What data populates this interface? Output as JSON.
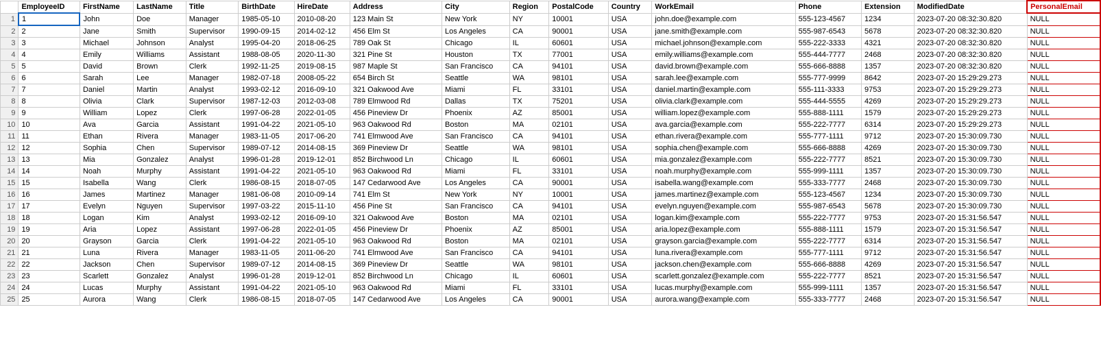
{
  "columns": [
    {
      "key": "rowNum",
      "label": ""
    },
    {
      "key": "employeeId",
      "label": "EmployeeID"
    },
    {
      "key": "firstName",
      "label": "FirstName"
    },
    {
      "key": "lastName",
      "label": "LastName"
    },
    {
      "key": "title",
      "label": "Title"
    },
    {
      "key": "birthDate",
      "label": "BirthDate"
    },
    {
      "key": "hireDate",
      "label": "HireDate"
    },
    {
      "key": "address",
      "label": "Address"
    },
    {
      "key": "city",
      "label": "City"
    },
    {
      "key": "region",
      "label": "Region"
    },
    {
      "key": "postalCode",
      "label": "PostalCode"
    },
    {
      "key": "country",
      "label": "Country"
    },
    {
      "key": "workEmail",
      "label": "WorkEmail"
    },
    {
      "key": "phone",
      "label": "Phone"
    },
    {
      "key": "extension",
      "label": "Extension"
    },
    {
      "key": "modifiedDate",
      "label": "ModifiedDate"
    },
    {
      "key": "personalEmail",
      "label": "PersonalEmail"
    }
  ],
  "rows": [
    {
      "rowNum": 1,
      "employeeId": "1",
      "firstName": "John",
      "lastName": "Doe",
      "title": "Manager",
      "birthDate": "1985-05-10",
      "hireDate": "2010-08-20",
      "address": "123 Main St",
      "city": "New York",
      "region": "NY",
      "postalCode": "10001",
      "country": "USA",
      "workEmail": "john.doe@example.com",
      "phone": "555-123-4567",
      "extension": "1234",
      "modifiedDate": "2023-07-20 08:32:30.820",
      "personalEmail": "NULL"
    },
    {
      "rowNum": 2,
      "employeeId": "2",
      "firstName": "Jane",
      "lastName": "Smith",
      "title": "Supervisor",
      "birthDate": "1990-09-15",
      "hireDate": "2014-02-12",
      "address": "456 Elm St",
      "city": "Los Angeles",
      "region": "CA",
      "postalCode": "90001",
      "country": "USA",
      "workEmail": "jane.smith@example.com",
      "phone": "555-987-6543",
      "extension": "5678",
      "modifiedDate": "2023-07-20 08:32:30.820",
      "personalEmail": "NULL"
    },
    {
      "rowNum": 3,
      "employeeId": "3",
      "firstName": "Michael",
      "lastName": "Johnson",
      "title": "Analyst",
      "birthDate": "1995-04-20",
      "hireDate": "2018-06-25",
      "address": "789 Oak St",
      "city": "Chicago",
      "region": "IL",
      "postalCode": "60601",
      "country": "USA",
      "workEmail": "michael.johnson@example.com",
      "phone": "555-222-3333",
      "extension": "4321",
      "modifiedDate": "2023-07-20 08:32:30.820",
      "personalEmail": "NULL"
    },
    {
      "rowNum": 4,
      "employeeId": "4",
      "firstName": "Emily",
      "lastName": "Williams",
      "title": "Assistant",
      "birthDate": "1988-08-05",
      "hireDate": "2020-11-30",
      "address": "321 Pine St",
      "city": "Houston",
      "region": "TX",
      "postalCode": "77001",
      "country": "USA",
      "workEmail": "emily.williams@example.com",
      "phone": "555-444-7777",
      "extension": "2468",
      "modifiedDate": "2023-07-20 08:32:30.820",
      "personalEmail": "NULL"
    },
    {
      "rowNum": 5,
      "employeeId": "5",
      "firstName": "David",
      "lastName": "Brown",
      "title": "Clerk",
      "birthDate": "1992-11-25",
      "hireDate": "2019-08-15",
      "address": "987 Maple St",
      "city": "San Francisco",
      "region": "CA",
      "postalCode": "94101",
      "country": "USA",
      "workEmail": "david.brown@example.com",
      "phone": "555-666-8888",
      "extension": "1357",
      "modifiedDate": "2023-07-20 08:32:30.820",
      "personalEmail": "NULL"
    },
    {
      "rowNum": 6,
      "employeeId": "6",
      "firstName": "Sarah",
      "lastName": "Lee",
      "title": "Manager",
      "birthDate": "1982-07-18",
      "hireDate": "2008-05-22",
      "address": "654 Birch St",
      "city": "Seattle",
      "region": "WA",
      "postalCode": "98101",
      "country": "USA",
      "workEmail": "sarah.lee@example.com",
      "phone": "555-777-9999",
      "extension": "8642",
      "modifiedDate": "2023-07-20 15:29:29.273",
      "personalEmail": "NULL"
    },
    {
      "rowNum": 7,
      "employeeId": "7",
      "firstName": "Daniel",
      "lastName": "Martin",
      "title": "Analyst",
      "birthDate": "1993-02-12",
      "hireDate": "2016-09-10",
      "address": "321 Oakwood Ave",
      "city": "Miami",
      "region": "FL",
      "postalCode": "33101",
      "country": "USA",
      "workEmail": "daniel.martin@example.com",
      "phone": "555-111-3333",
      "extension": "9753",
      "modifiedDate": "2023-07-20 15:29:29.273",
      "personalEmail": "NULL"
    },
    {
      "rowNum": 8,
      "employeeId": "8",
      "firstName": "Olivia",
      "lastName": "Clark",
      "title": "Supervisor",
      "birthDate": "1987-12-03",
      "hireDate": "2012-03-08",
      "address": "789 Elmwood Rd",
      "city": "Dallas",
      "region": "TX",
      "postalCode": "75201",
      "country": "USA",
      "workEmail": "olivia.clark@example.com",
      "phone": "555-444-5555",
      "extension": "4269",
      "modifiedDate": "2023-07-20 15:29:29.273",
      "personalEmail": "NULL"
    },
    {
      "rowNum": 9,
      "employeeId": "9",
      "firstName": "William",
      "lastName": "Lopez",
      "title": "Clerk",
      "birthDate": "1997-06-28",
      "hireDate": "2022-01-05",
      "address": "456 Pineview Dr",
      "city": "Phoenix",
      "region": "AZ",
      "postalCode": "85001",
      "country": "USA",
      "workEmail": "william.lopez@example.com",
      "phone": "555-888-1111",
      "extension": "1579",
      "modifiedDate": "2023-07-20 15:29:29.273",
      "personalEmail": "NULL"
    },
    {
      "rowNum": 10,
      "employeeId": "10",
      "firstName": "Ava",
      "lastName": "Garcia",
      "title": "Assistant",
      "birthDate": "1991-04-22",
      "hireDate": "2021-05-10",
      "address": "963 Oakwood Rd",
      "city": "Boston",
      "region": "MA",
      "postalCode": "02101",
      "country": "USA",
      "workEmail": "ava.garcia@example.com",
      "phone": "555-222-7777",
      "extension": "6314",
      "modifiedDate": "2023-07-20 15:29:29.273",
      "personalEmail": "NULL"
    },
    {
      "rowNum": 11,
      "employeeId": "11",
      "firstName": "Ethan",
      "lastName": "Rivera",
      "title": "Manager",
      "birthDate": "1983-11-05",
      "hireDate": "2017-06-20",
      "address": "741 Elmwood Ave",
      "city": "San Francisco",
      "region": "CA",
      "postalCode": "94101",
      "country": "USA",
      "workEmail": "ethan.rivera@example.com",
      "phone": "555-777-1111",
      "extension": "9712",
      "modifiedDate": "2023-07-20 15:30:09.730",
      "personalEmail": "NULL"
    },
    {
      "rowNum": 12,
      "employeeId": "12",
      "firstName": "Sophia",
      "lastName": "Chen",
      "title": "Supervisor",
      "birthDate": "1989-07-12",
      "hireDate": "2014-08-15",
      "address": "369 Pineview Dr",
      "city": "Seattle",
      "region": "WA",
      "postalCode": "98101",
      "country": "USA",
      "workEmail": "sophia.chen@example.com",
      "phone": "555-666-8888",
      "extension": "4269",
      "modifiedDate": "2023-07-20 15:30:09.730",
      "personalEmail": "NULL"
    },
    {
      "rowNum": 13,
      "employeeId": "13",
      "firstName": "Mia",
      "lastName": "Gonzalez",
      "title": "Analyst",
      "birthDate": "1996-01-28",
      "hireDate": "2019-12-01",
      "address": "852 Birchwood Ln",
      "city": "Chicago",
      "region": "IL",
      "postalCode": "60601",
      "country": "USA",
      "workEmail": "mia.gonzalez@example.com",
      "phone": "555-222-7777",
      "extension": "8521",
      "modifiedDate": "2023-07-20 15:30:09.730",
      "personalEmail": "NULL"
    },
    {
      "rowNum": 14,
      "employeeId": "14",
      "firstName": "Noah",
      "lastName": "Murphy",
      "title": "Assistant",
      "birthDate": "1991-04-22",
      "hireDate": "2021-05-10",
      "address": "963 Oakwood Rd",
      "city": "Miami",
      "region": "FL",
      "postalCode": "33101",
      "country": "USA",
      "workEmail": "noah.murphy@example.com",
      "phone": "555-999-1111",
      "extension": "1357",
      "modifiedDate": "2023-07-20 15:30:09.730",
      "personalEmail": "NULL"
    },
    {
      "rowNum": 15,
      "employeeId": "15",
      "firstName": "Isabella",
      "lastName": "Wang",
      "title": "Clerk",
      "birthDate": "1986-08-15",
      "hireDate": "2018-07-05",
      "address": "147 Cedarwood Ave",
      "city": "Los Angeles",
      "region": "CA",
      "postalCode": "90001",
      "country": "USA",
      "workEmail": "isabella.wang@example.com",
      "phone": "555-333-7777",
      "extension": "2468",
      "modifiedDate": "2023-07-20 15:30:09.730",
      "personalEmail": "NULL"
    },
    {
      "rowNum": 16,
      "employeeId": "16",
      "firstName": "James",
      "lastName": "Martinez",
      "title": "Manager",
      "birthDate": "1981-06-08",
      "hireDate": "2010-09-14",
      "address": "741 Elm St",
      "city": "New York",
      "region": "NY",
      "postalCode": "10001",
      "country": "USA",
      "workEmail": "james.martinez@example.com",
      "phone": "555-123-4567",
      "extension": "1234",
      "modifiedDate": "2023-07-20 15:30:09.730",
      "personalEmail": "NULL"
    },
    {
      "rowNum": 17,
      "employeeId": "17",
      "firstName": "Evelyn",
      "lastName": "Nguyen",
      "title": "Supervisor",
      "birthDate": "1997-03-22",
      "hireDate": "2015-11-10",
      "address": "456 Pine St",
      "city": "San Francisco",
      "region": "CA",
      "postalCode": "94101",
      "country": "USA",
      "workEmail": "evelyn.nguyen@example.com",
      "phone": "555-987-6543",
      "extension": "5678",
      "modifiedDate": "2023-07-20 15:30:09.730",
      "personalEmail": "NULL"
    },
    {
      "rowNum": 18,
      "employeeId": "18",
      "firstName": "Logan",
      "lastName": "Kim",
      "title": "Analyst",
      "birthDate": "1993-02-12",
      "hireDate": "2016-09-10",
      "address": "321 Oakwood Ave",
      "city": "Boston",
      "region": "MA",
      "postalCode": "02101",
      "country": "USA",
      "workEmail": "logan.kim@example.com",
      "phone": "555-222-7777",
      "extension": "9753",
      "modifiedDate": "2023-07-20 15:31:56.547",
      "personalEmail": "NULL"
    },
    {
      "rowNum": 19,
      "employeeId": "19",
      "firstName": "Aria",
      "lastName": "Lopez",
      "title": "Assistant",
      "birthDate": "1997-06-28",
      "hireDate": "2022-01-05",
      "address": "456 Pineview Dr",
      "city": "Phoenix",
      "region": "AZ",
      "postalCode": "85001",
      "country": "USA",
      "workEmail": "aria.lopez@example.com",
      "phone": "555-888-1111",
      "extension": "1579",
      "modifiedDate": "2023-07-20 15:31:56.547",
      "personalEmail": "NULL"
    },
    {
      "rowNum": 20,
      "employeeId": "20",
      "firstName": "Grayson",
      "lastName": "Garcia",
      "title": "Clerk",
      "birthDate": "1991-04-22",
      "hireDate": "2021-05-10",
      "address": "963 Oakwood Rd",
      "city": "Boston",
      "region": "MA",
      "postalCode": "02101",
      "country": "USA",
      "workEmail": "grayson.garcia@example.com",
      "phone": "555-222-7777",
      "extension": "6314",
      "modifiedDate": "2023-07-20 15:31:56.547",
      "personalEmail": "NULL"
    },
    {
      "rowNum": 21,
      "employeeId": "21",
      "firstName": "Luna",
      "lastName": "Rivera",
      "title": "Manager",
      "birthDate": "1983-11-05",
      "hireDate": "2011-06-20",
      "address": "741 Elmwood Ave",
      "city": "San Francisco",
      "region": "CA",
      "postalCode": "94101",
      "country": "USA",
      "workEmail": "luna.rivera@example.com",
      "phone": "555-777-1111",
      "extension": "9712",
      "modifiedDate": "2023-07-20 15:31:56.547",
      "personalEmail": "NULL"
    },
    {
      "rowNum": 22,
      "employeeId": "22",
      "firstName": "Jackson",
      "lastName": "Chen",
      "title": "Supervisor",
      "birthDate": "1989-07-12",
      "hireDate": "2014-08-15",
      "address": "369 Pineview Dr",
      "city": "Seattle",
      "region": "WA",
      "postalCode": "98101",
      "country": "USA",
      "workEmail": "jackson.chen@example.com",
      "phone": "555-666-8888",
      "extension": "4269",
      "modifiedDate": "2023-07-20 15:31:56.547",
      "personalEmail": "NULL"
    },
    {
      "rowNum": 23,
      "employeeId": "23",
      "firstName": "Scarlett",
      "lastName": "Gonzalez",
      "title": "Analyst",
      "birthDate": "1996-01-28",
      "hireDate": "2019-12-01",
      "address": "852 Birchwood Ln",
      "city": "Chicago",
      "region": "IL",
      "postalCode": "60601",
      "country": "USA",
      "workEmail": "scarlett.gonzalez@example.com",
      "phone": "555-222-7777",
      "extension": "8521",
      "modifiedDate": "2023-07-20 15:31:56.547",
      "personalEmail": "NULL"
    },
    {
      "rowNum": 24,
      "employeeId": "24",
      "firstName": "Lucas",
      "lastName": "Murphy",
      "title": "Assistant",
      "birthDate": "1991-04-22",
      "hireDate": "2021-05-10",
      "address": "963 Oakwood Rd",
      "city": "Miami",
      "region": "FL",
      "postalCode": "33101",
      "country": "USA",
      "workEmail": "lucas.murphy@example.com",
      "phone": "555-999-1111",
      "extension": "1357",
      "modifiedDate": "2023-07-20 15:31:56.547",
      "personalEmail": "NULL"
    },
    {
      "rowNum": 25,
      "employeeId": "25",
      "firstName": "Aurora",
      "lastName": "Wang",
      "title": "Clerk",
      "birthDate": "1986-08-15",
      "hireDate": "2018-07-05",
      "address": "147 Cedarwood Ave",
      "city": "Los Angeles",
      "region": "CA",
      "postalCode": "90001",
      "country": "USA",
      "workEmail": "aurora.wang@example.com",
      "phone": "555-333-7777",
      "extension": "2468",
      "modifiedDate": "2023-07-20 15:31:56.547",
      "personalEmail": "NULL"
    }
  ]
}
